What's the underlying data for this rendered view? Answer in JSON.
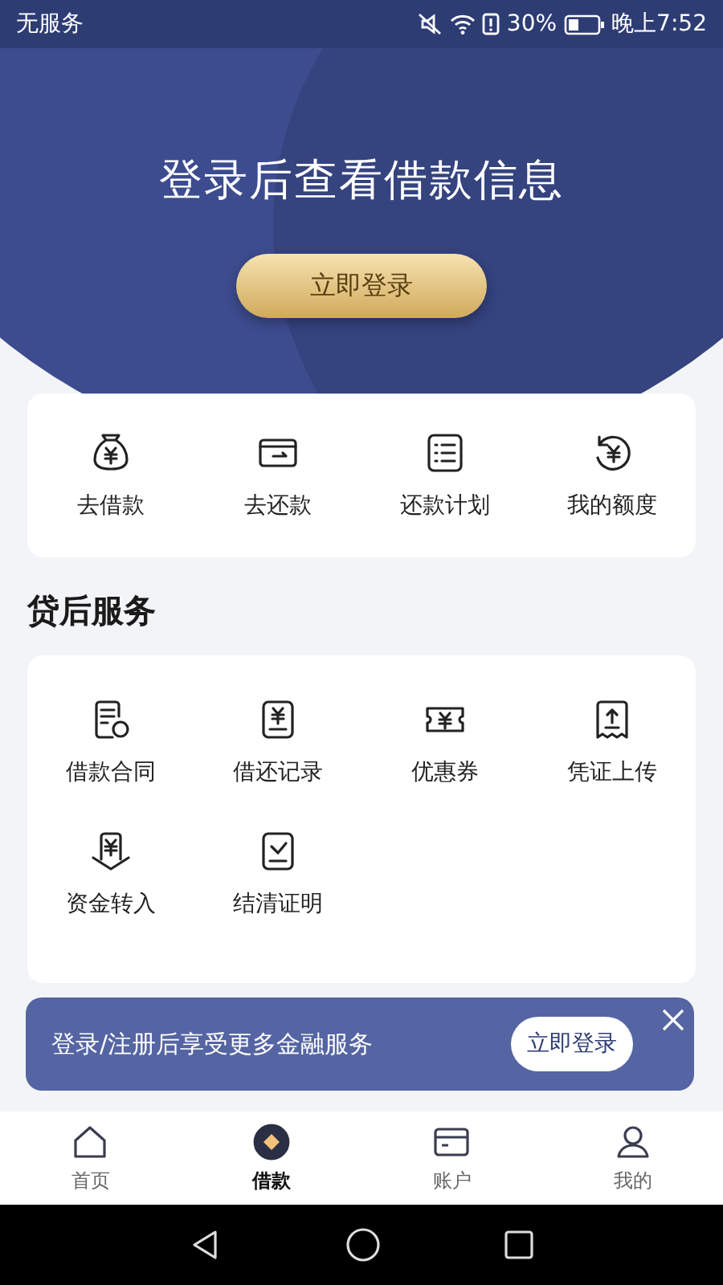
{
  "status_bar": {
    "carrier": "无服务",
    "battery": "30%",
    "time": "晚上7:52"
  },
  "hero": {
    "title": "登录后查看借款信息",
    "button": "立即登录"
  },
  "quick_actions": [
    {
      "label": "去借款"
    },
    {
      "label": "去还款"
    },
    {
      "label": "还款计划"
    },
    {
      "label": "我的额度"
    }
  ],
  "after_loan": {
    "title": "贷后服务",
    "items": [
      {
        "label": "借款合同"
      },
      {
        "label": "借还记录"
      },
      {
        "label": "优惠券"
      },
      {
        "label": "凭证上传"
      },
      {
        "label": "资金转入"
      },
      {
        "label": "结清证明"
      }
    ]
  },
  "promo_banner": {
    "text": "登录/注册后享受更多金融服务",
    "button": "立即登录"
  },
  "tab_bar": [
    {
      "label": "首页",
      "selected": false
    },
    {
      "label": "借款",
      "selected": true
    },
    {
      "label": "账户",
      "selected": false
    },
    {
      "label": "我的",
      "selected": false
    }
  ]
}
